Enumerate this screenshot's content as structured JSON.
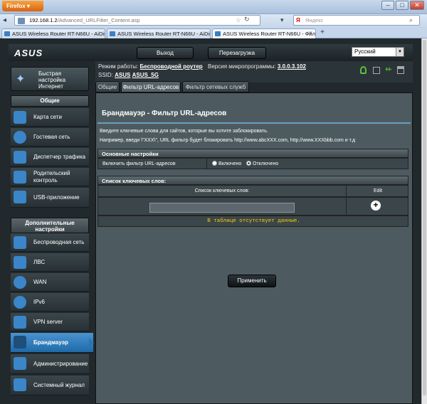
{
  "browser": {
    "app_button": "Firefox",
    "url_host": "192.168.1.2",
    "url_path": "/Advanced_URLFilter_Content.asp",
    "search_placeholder": "Яндекс",
    "tabs": [
      {
        "title": "ASUS Wireless Router RT-N66U - AiDisk"
      },
      {
        "title": "ASUS Wireless Router RT-N66U - AiDisk"
      },
      {
        "title": "ASUS Wireless Router RT-N66U - Фил..."
      }
    ],
    "new_tab": "+"
  },
  "router": {
    "logo": "ASUS",
    "logout": "Выход",
    "reboot": "Перезагрузка",
    "language": "Русский",
    "info": {
      "mode_label": "Режим работы:",
      "mode_value": "Беспроводной роутер",
      "fw_label": "Версия микропрограммы:",
      "fw_value": "3.0.0.3.102",
      "ssid_label": "SSID:",
      "ssid_1": "ASUS",
      "ssid_2": "ASUS_5G"
    }
  },
  "sidebar": {
    "quick_setup": "Быстрая настройка Интернет",
    "general_header": "Общие",
    "general_items": [
      {
        "label": "Карта сети"
      },
      {
        "label": "Гостевая сеть"
      },
      {
        "label": "Диспетчер трафика"
      },
      {
        "label": "Родительский контроль"
      },
      {
        "label": "USB-приложение"
      }
    ],
    "advanced_header": "Дополнительные настройки",
    "advanced_items": [
      {
        "label": "Беспроводная сеть"
      },
      {
        "label": "ЛВС"
      },
      {
        "label": "WAN"
      },
      {
        "label": "IPv6"
      },
      {
        "label": "VPN server"
      },
      {
        "label": "Брандмауэр"
      },
      {
        "label": "Админи­стри­рование"
      },
      {
        "label": "Системный журнал"
      }
    ]
  },
  "subtabs": [
    "Общие",
    "Фильтр URL-адресов",
    "Фильтр сетевых служб"
  ],
  "content": {
    "title": "Брандмауэр - Фильтр URL-адресов",
    "desc1": "Введите ключевые слова для сайтов, которые вы хотите заблокировать.",
    "desc2": "Например, введи \\\"XXX\\\", URL фильтр будет блокировать http://www.abcXXX.com, http://www.XXXbbb.com и т.д",
    "basic_header": "Основные настройки",
    "enable_label": "Включить фильтр URL-адресов",
    "opt_on": "Включено",
    "opt_off": "Отключено",
    "list_header": "Список ключевых слов:",
    "col_keywords": "Список ключевых слов:",
    "col_edit": "Edit",
    "add_symbol": "+",
    "empty_msg": "В таблице отсутствует данные.",
    "apply": "Применить"
  }
}
